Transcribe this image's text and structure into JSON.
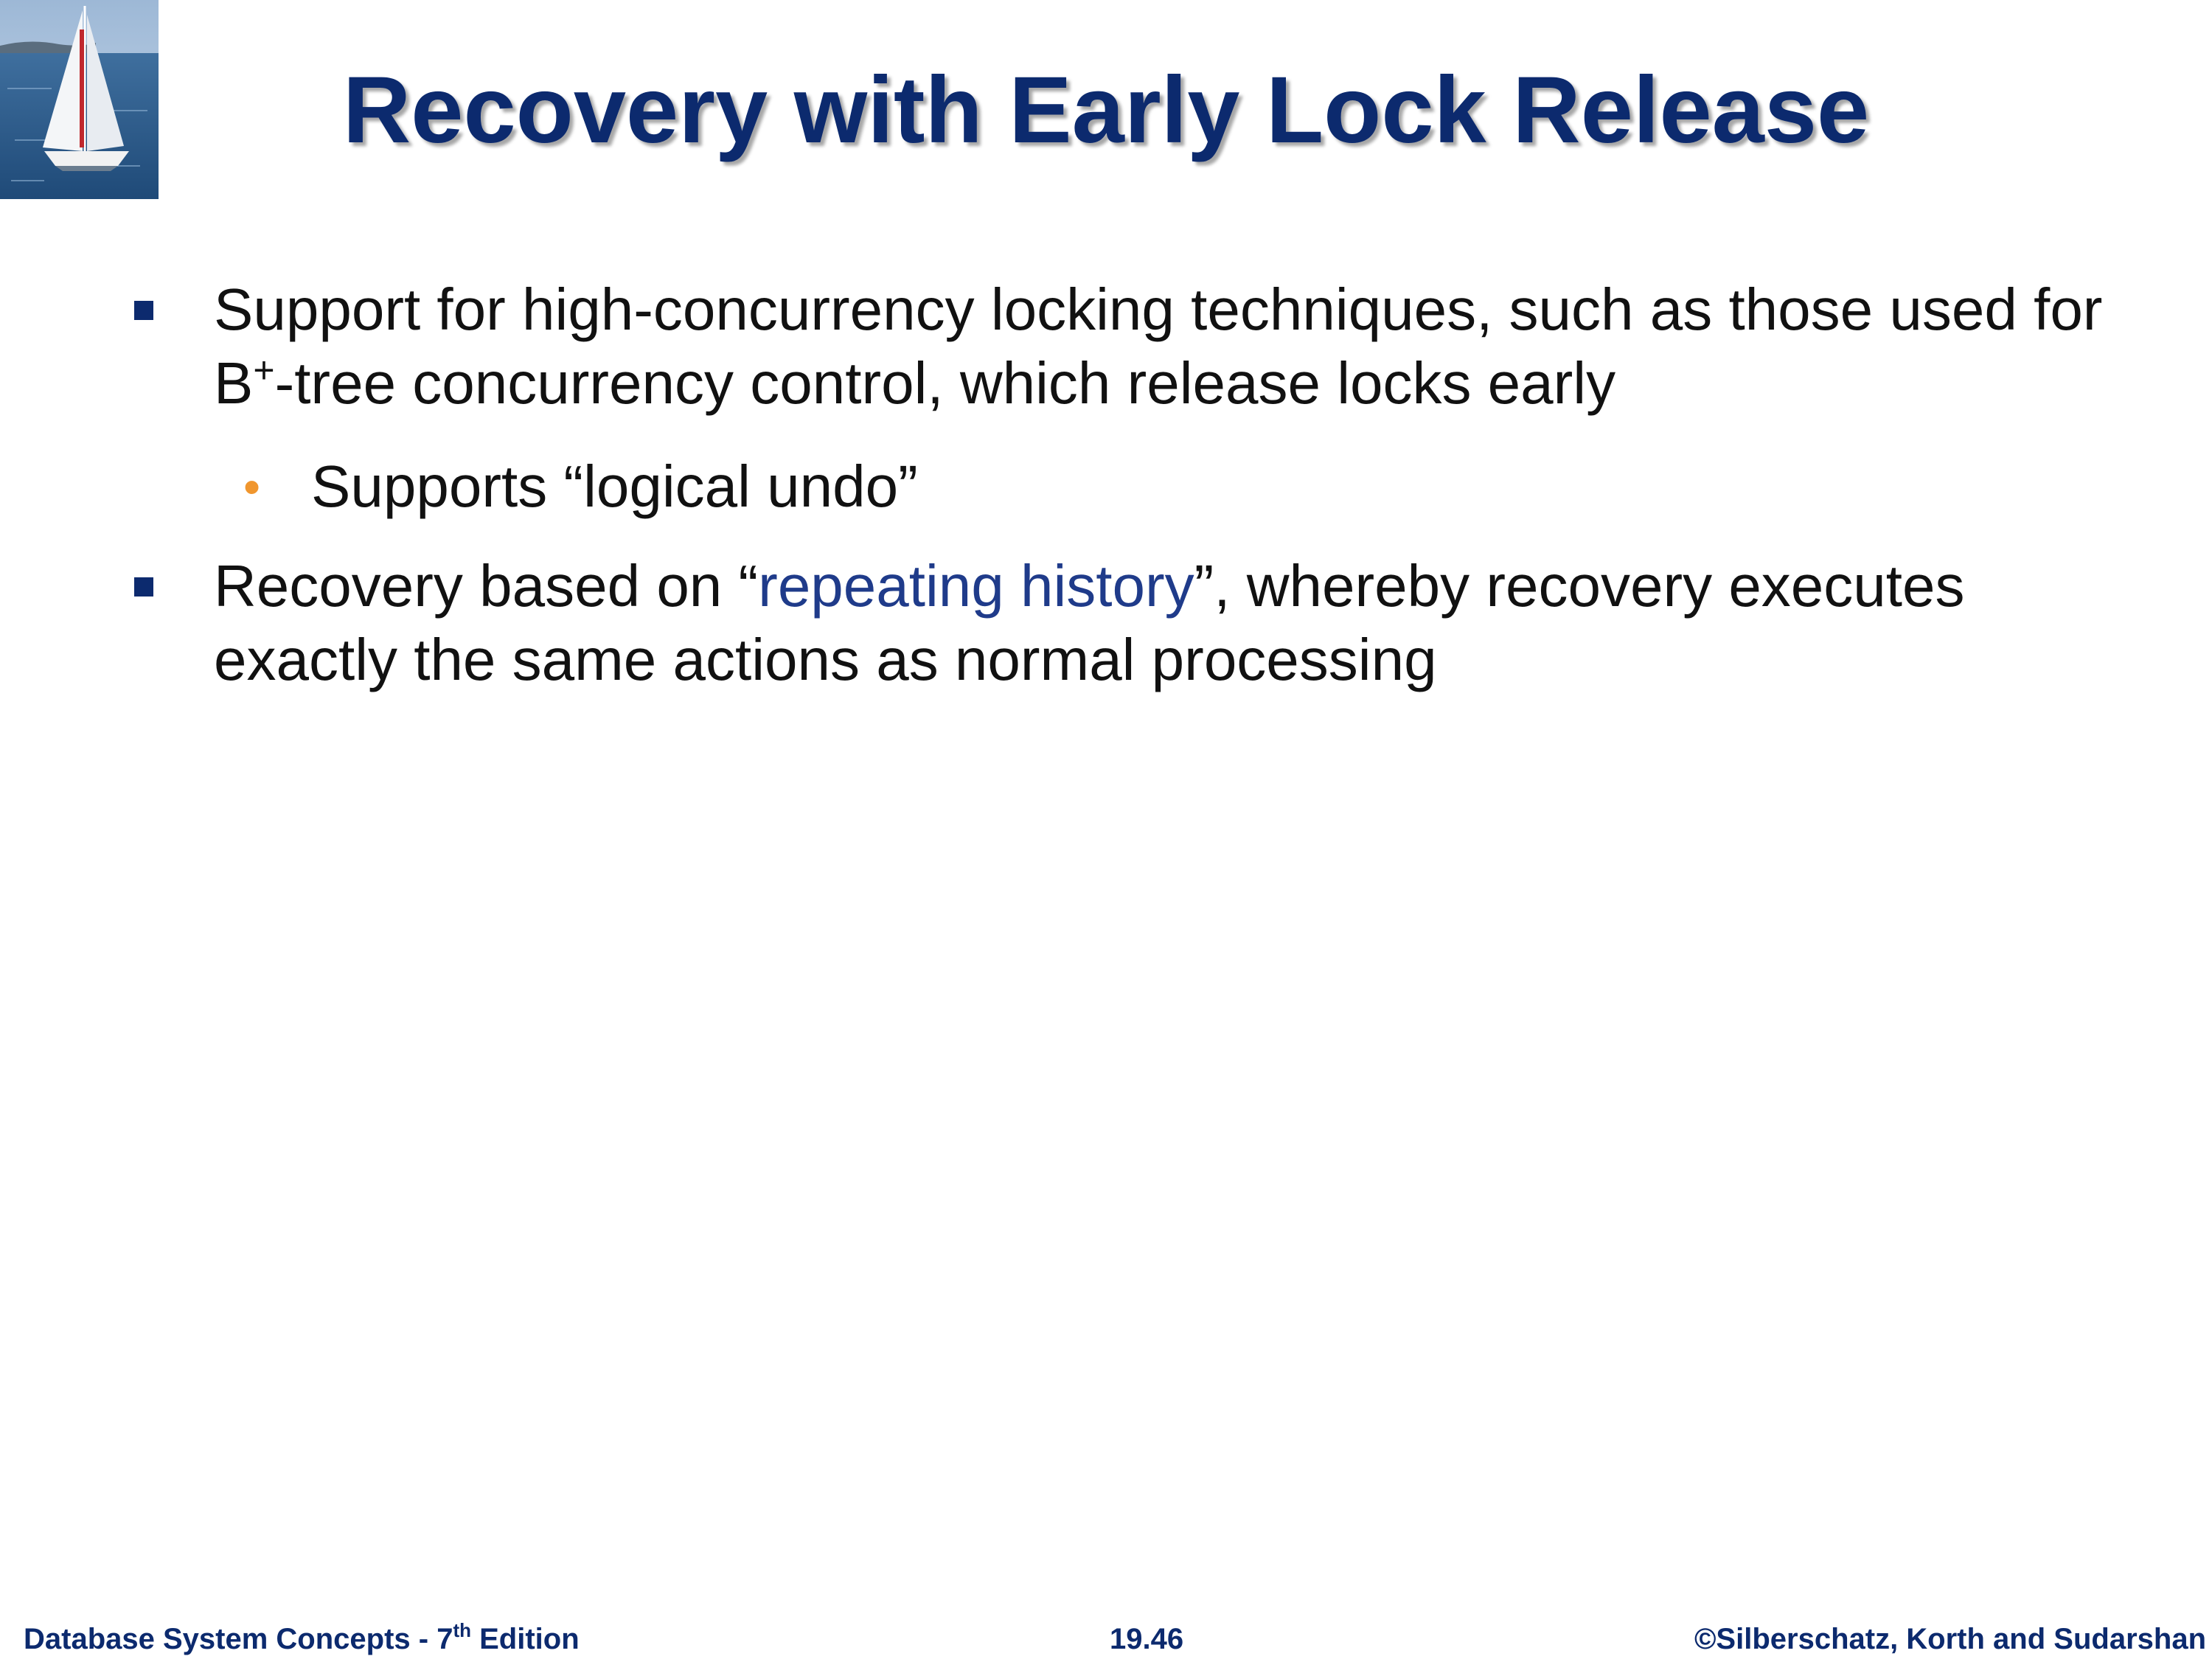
{
  "slide": {
    "title": "Recovery with Early Lock Release",
    "bullets": [
      {
        "text_part1": "Support for high-concurrency locking techniques, such as those used for B",
        "superscript": "+",
        "text_part2": "-tree concurrency control, which release locks early",
        "sub_bullets": [
          {
            "text_before": "Supports ",
            "quote_open": "“",
            "quoted": "logical undo",
            "quote_close": "”"
          }
        ]
      },
      {
        "text_before": "Recovery based on ",
        "quote_open": "“",
        "highlight": "repeating history",
        "quote_close": "”",
        "text_after": ", whereby recovery executes exactly the same actions as normal processing"
      }
    ]
  },
  "footer": {
    "left_text": "Database System Concepts - 7",
    "left_sup": "th",
    "left_suffix": " Edition",
    "page_number": "19.46",
    "copyright": "©Silberschatz, Korth and Sudarshan"
  },
  "colors": {
    "title": "#0c2a6e",
    "bullet_marker": "#0c2a6e",
    "sub_bullet_marker": "#f0962e",
    "highlight": "#1f3b8a",
    "footer": "#0c2a6e"
  },
  "icons": {
    "logo": "sailboat-image",
    "bullet": "square-bullet-icon",
    "sub_bullet": "dot-bullet-icon"
  }
}
